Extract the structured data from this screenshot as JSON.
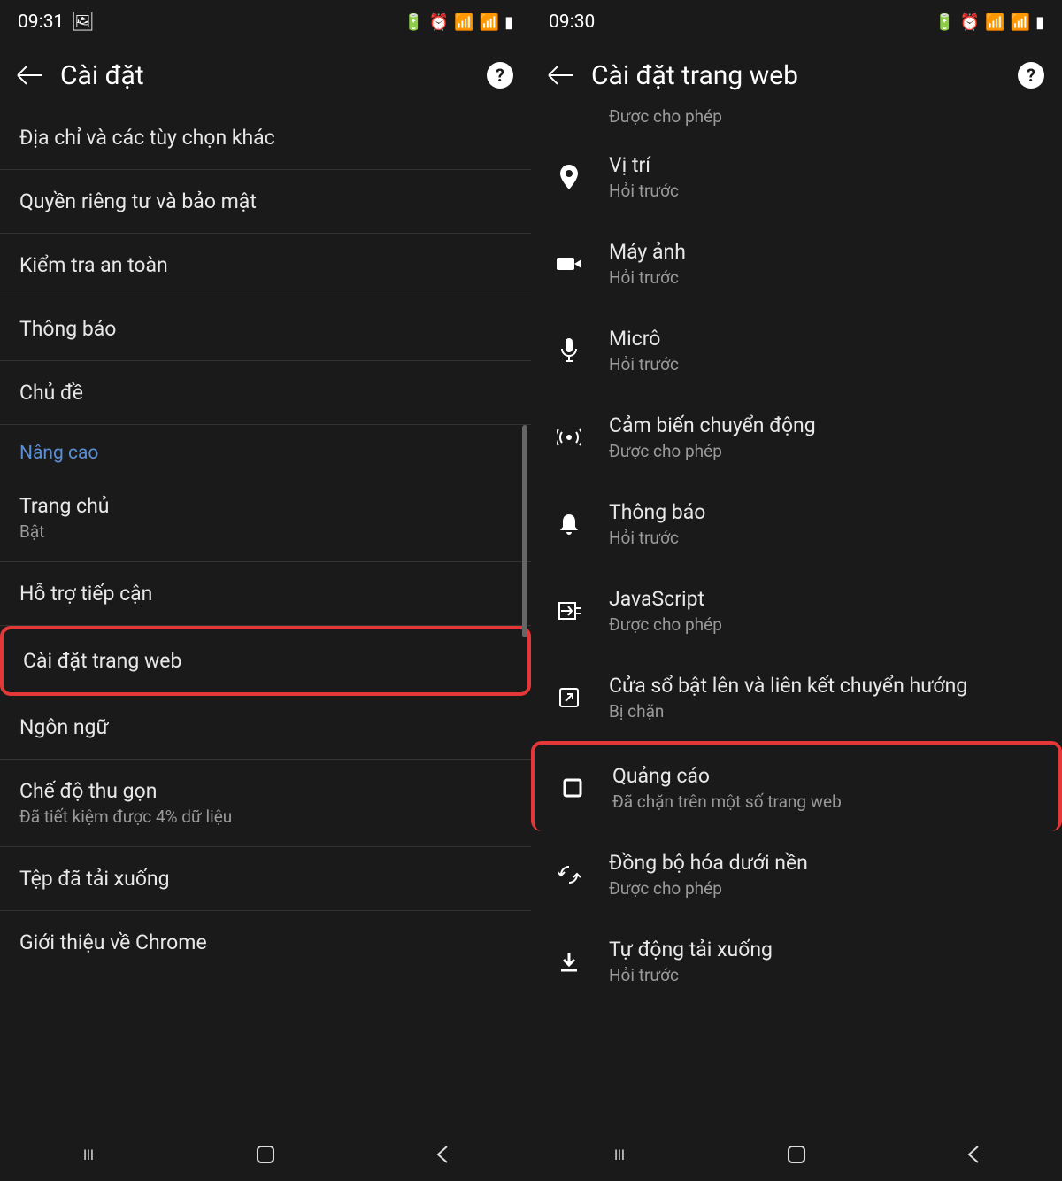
{
  "left": {
    "status_time": "09:31",
    "title": "Cài đặt",
    "items": [
      {
        "primary": "Địa chỉ và các tùy chọn khác"
      },
      {
        "primary": "Quyền riêng tư và bảo mật"
      },
      {
        "primary": "Kiểm tra an toàn"
      },
      {
        "primary": "Thông báo"
      },
      {
        "primary": "Chủ đề"
      }
    ],
    "section": "Nâng cao",
    "items2": [
      {
        "primary": "Trang chủ",
        "secondary": "Bật"
      },
      {
        "primary": "Hỗ trợ tiếp cận"
      },
      {
        "primary": "Cài đặt trang web",
        "hl": true
      },
      {
        "primary": "Ngôn ngữ"
      },
      {
        "primary": "Chế độ thu gọn",
        "secondary": "Đã tiết kiệm được 4% dữ liệu"
      },
      {
        "primary": "Tệp đã tải xuống"
      },
      {
        "primary": "Giới thiệu về Chrome"
      }
    ]
  },
  "right": {
    "status_time": "09:30",
    "title": "Cài đặt trang web",
    "top_secondary": "Được cho phép",
    "items": [
      {
        "icon": "location",
        "primary": "Vị trí",
        "secondary": "Hỏi trước"
      },
      {
        "icon": "camera",
        "primary": "Máy ảnh",
        "secondary": "Hỏi trước"
      },
      {
        "icon": "mic",
        "primary": "Micrô",
        "secondary": "Hỏi trước"
      },
      {
        "icon": "motion",
        "primary": "Cảm biến chuyển động",
        "secondary": "Được cho phép"
      },
      {
        "icon": "bell",
        "primary": "Thông báo",
        "secondary": "Hỏi trước"
      },
      {
        "icon": "js",
        "primary": "JavaScript",
        "secondary": "Được cho phép"
      },
      {
        "icon": "popup",
        "primary": "Cửa sổ bật lên và liên kết chuyển hướng",
        "secondary": "Bị chặn"
      },
      {
        "icon": "ads",
        "primary": "Quảng cáo",
        "secondary": "Đã chặn trên một số trang web",
        "hl": true
      },
      {
        "icon": "sync",
        "primary": "Đồng bộ hóa dưới nền",
        "secondary": "Được cho phép"
      },
      {
        "icon": "download",
        "primary": "Tự động tải xuống",
        "secondary": "Hỏi trước"
      }
    ]
  }
}
